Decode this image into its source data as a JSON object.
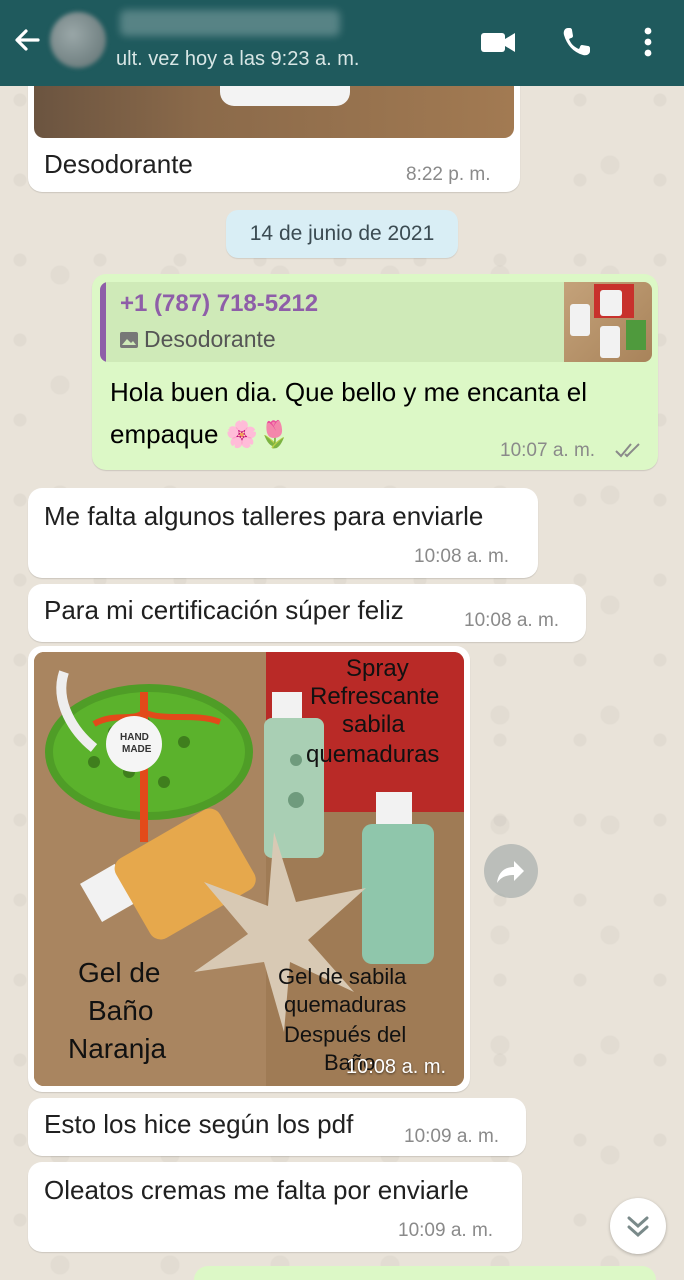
{
  "header": {
    "last_seen": "ult. vez hoy a las 9:23 a. m.",
    "icons": [
      "back-arrow-icon",
      "video-call-icon",
      "phone-icon",
      "more-vert-icon"
    ]
  },
  "messages": {
    "m1": {
      "text": "Desodorante",
      "time": "8:22 p. m."
    },
    "date_chip": "14 de junio de 2021",
    "m2": {
      "quote_author": "+1 (787) 718-5212",
      "quote_text": "Desodorante",
      "line1": "Hola buen dia. Que bello y me encanta el",
      "line2": "empaque 🌸🌷",
      "time": "10:07 a. m."
    },
    "m3": {
      "text": "Me falta algunos talleres para enviarle",
      "time": "10:08 a. m."
    },
    "m4": {
      "text": "Para mi certificación súper feliz",
      "time": "10:08 a. m."
    },
    "m5": {
      "photo_labels": {
        "spray": [
          "Spray",
          "Refrescante",
          "sabila",
          "quemaduras"
        ],
        "gel_bano": [
          "Gel de",
          "Baño",
          "Naranja"
        ],
        "gel_sabila": [
          "Gel de sabila",
          "quemaduras",
          "Después del",
          "Baño"
        ],
        "tag": [
          "HAND",
          "MADE"
        ]
      },
      "time": "10:08 a. m."
    },
    "m6": {
      "text": "Esto los hice según los pdf",
      "time": "10:09 a. m."
    },
    "m7": {
      "text": "Oleatos cremas me falta por enviarle",
      "time": "10:09 a. m."
    }
  },
  "colors": {
    "header": "#1f5a5d",
    "outgoing_bubble": "#dcf8c6",
    "incoming_bubble": "#ffffff",
    "quote_author": "#8e5ea8",
    "read_ticks": "#8a8a8a"
  }
}
